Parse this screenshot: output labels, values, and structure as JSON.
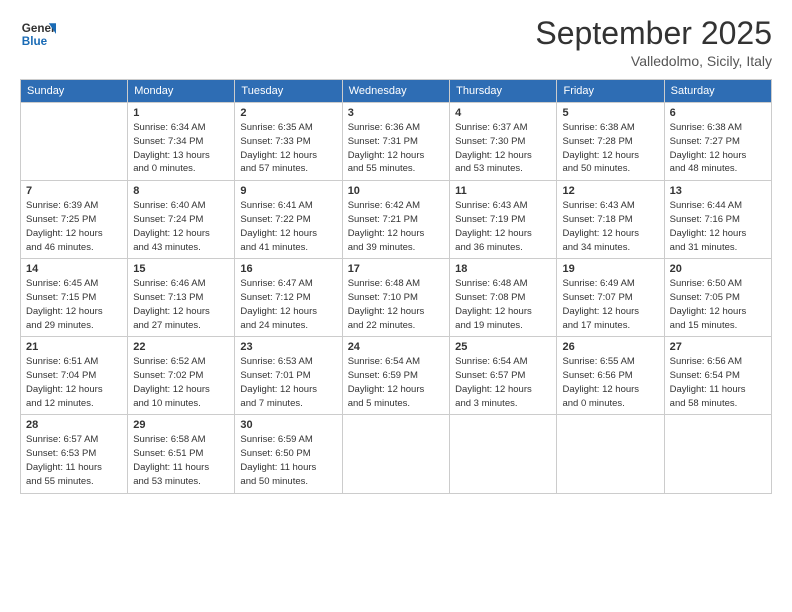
{
  "logo": {
    "line1": "General",
    "line2": "Blue"
  },
  "title": "September 2025",
  "location": "Valledolmo, Sicily, Italy",
  "weekdays": [
    "Sunday",
    "Monday",
    "Tuesday",
    "Wednesday",
    "Thursday",
    "Friday",
    "Saturday"
  ],
  "weeks": [
    [
      {
        "day": "",
        "info": ""
      },
      {
        "day": "1",
        "info": "Sunrise: 6:34 AM\nSunset: 7:34 PM\nDaylight: 13 hours\nand 0 minutes."
      },
      {
        "day": "2",
        "info": "Sunrise: 6:35 AM\nSunset: 7:33 PM\nDaylight: 12 hours\nand 57 minutes."
      },
      {
        "day": "3",
        "info": "Sunrise: 6:36 AM\nSunset: 7:31 PM\nDaylight: 12 hours\nand 55 minutes."
      },
      {
        "day": "4",
        "info": "Sunrise: 6:37 AM\nSunset: 7:30 PM\nDaylight: 12 hours\nand 53 minutes."
      },
      {
        "day": "5",
        "info": "Sunrise: 6:38 AM\nSunset: 7:28 PM\nDaylight: 12 hours\nand 50 minutes."
      },
      {
        "day": "6",
        "info": "Sunrise: 6:38 AM\nSunset: 7:27 PM\nDaylight: 12 hours\nand 48 minutes."
      }
    ],
    [
      {
        "day": "7",
        "info": "Sunrise: 6:39 AM\nSunset: 7:25 PM\nDaylight: 12 hours\nand 46 minutes."
      },
      {
        "day": "8",
        "info": "Sunrise: 6:40 AM\nSunset: 7:24 PM\nDaylight: 12 hours\nand 43 minutes."
      },
      {
        "day": "9",
        "info": "Sunrise: 6:41 AM\nSunset: 7:22 PM\nDaylight: 12 hours\nand 41 minutes."
      },
      {
        "day": "10",
        "info": "Sunrise: 6:42 AM\nSunset: 7:21 PM\nDaylight: 12 hours\nand 39 minutes."
      },
      {
        "day": "11",
        "info": "Sunrise: 6:43 AM\nSunset: 7:19 PM\nDaylight: 12 hours\nand 36 minutes."
      },
      {
        "day": "12",
        "info": "Sunrise: 6:43 AM\nSunset: 7:18 PM\nDaylight: 12 hours\nand 34 minutes."
      },
      {
        "day": "13",
        "info": "Sunrise: 6:44 AM\nSunset: 7:16 PM\nDaylight: 12 hours\nand 31 minutes."
      }
    ],
    [
      {
        "day": "14",
        "info": "Sunrise: 6:45 AM\nSunset: 7:15 PM\nDaylight: 12 hours\nand 29 minutes."
      },
      {
        "day": "15",
        "info": "Sunrise: 6:46 AM\nSunset: 7:13 PM\nDaylight: 12 hours\nand 27 minutes."
      },
      {
        "day": "16",
        "info": "Sunrise: 6:47 AM\nSunset: 7:12 PM\nDaylight: 12 hours\nand 24 minutes."
      },
      {
        "day": "17",
        "info": "Sunrise: 6:48 AM\nSunset: 7:10 PM\nDaylight: 12 hours\nand 22 minutes."
      },
      {
        "day": "18",
        "info": "Sunrise: 6:48 AM\nSunset: 7:08 PM\nDaylight: 12 hours\nand 19 minutes."
      },
      {
        "day": "19",
        "info": "Sunrise: 6:49 AM\nSunset: 7:07 PM\nDaylight: 12 hours\nand 17 minutes."
      },
      {
        "day": "20",
        "info": "Sunrise: 6:50 AM\nSunset: 7:05 PM\nDaylight: 12 hours\nand 15 minutes."
      }
    ],
    [
      {
        "day": "21",
        "info": "Sunrise: 6:51 AM\nSunset: 7:04 PM\nDaylight: 12 hours\nand 12 minutes."
      },
      {
        "day": "22",
        "info": "Sunrise: 6:52 AM\nSunset: 7:02 PM\nDaylight: 12 hours\nand 10 minutes."
      },
      {
        "day": "23",
        "info": "Sunrise: 6:53 AM\nSunset: 7:01 PM\nDaylight: 12 hours\nand 7 minutes."
      },
      {
        "day": "24",
        "info": "Sunrise: 6:54 AM\nSunset: 6:59 PM\nDaylight: 12 hours\nand 5 minutes."
      },
      {
        "day": "25",
        "info": "Sunrise: 6:54 AM\nSunset: 6:57 PM\nDaylight: 12 hours\nand 3 minutes."
      },
      {
        "day": "26",
        "info": "Sunrise: 6:55 AM\nSunset: 6:56 PM\nDaylight: 12 hours\nand 0 minutes."
      },
      {
        "day": "27",
        "info": "Sunrise: 6:56 AM\nSunset: 6:54 PM\nDaylight: 11 hours\nand 58 minutes."
      }
    ],
    [
      {
        "day": "28",
        "info": "Sunrise: 6:57 AM\nSunset: 6:53 PM\nDaylight: 11 hours\nand 55 minutes."
      },
      {
        "day": "29",
        "info": "Sunrise: 6:58 AM\nSunset: 6:51 PM\nDaylight: 11 hours\nand 53 minutes."
      },
      {
        "day": "30",
        "info": "Sunrise: 6:59 AM\nSunset: 6:50 PM\nDaylight: 11 hours\nand 50 minutes."
      },
      {
        "day": "",
        "info": ""
      },
      {
        "day": "",
        "info": ""
      },
      {
        "day": "",
        "info": ""
      },
      {
        "day": "",
        "info": ""
      }
    ]
  ]
}
